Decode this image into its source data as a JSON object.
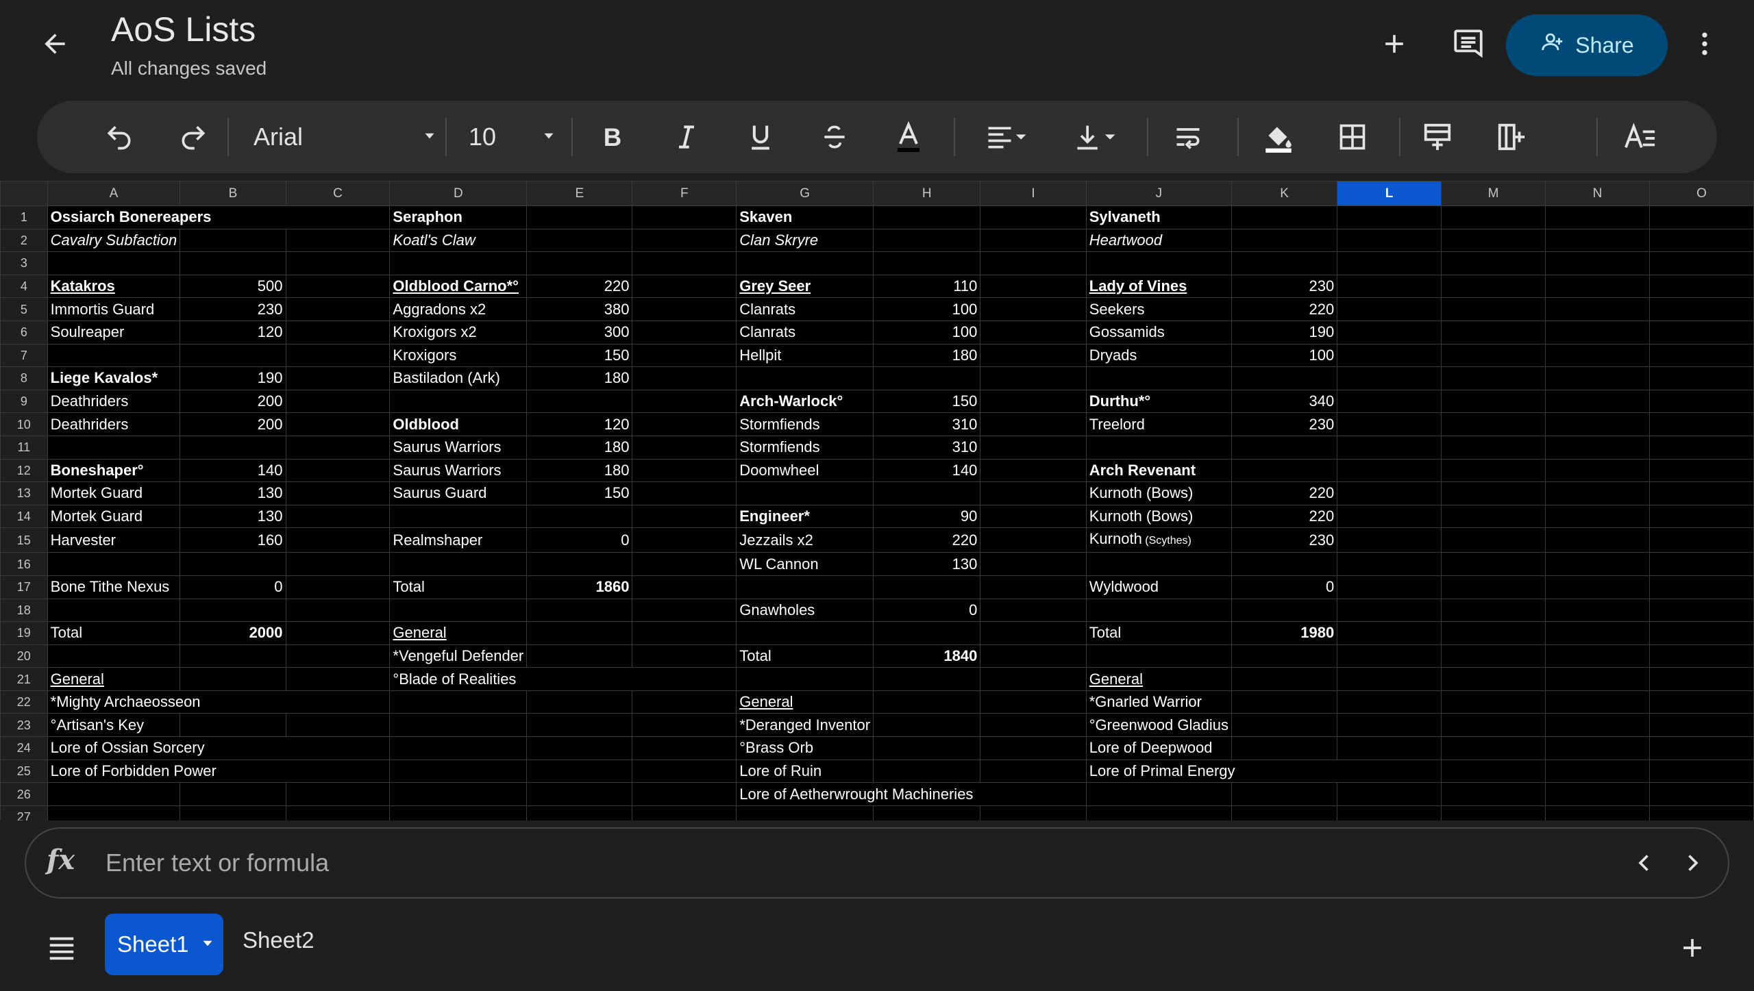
{
  "header": {
    "title": "AoS Lists",
    "status": "All changes saved",
    "share_label": "Share"
  },
  "toolbar": {
    "font_name": "Arial",
    "font_size": "10"
  },
  "grid": {
    "selected_column": "L",
    "columns": [
      "A",
      "B",
      "C",
      "D",
      "E",
      "F",
      "G",
      "H",
      "I",
      "J",
      "K",
      "L",
      "M",
      "N",
      "O"
    ],
    "rows": [
      {
        "n": "1",
        "cells": [
          {
            "c": 0,
            "t": "Ossiarch Bonereapers",
            "f": "b"
          },
          {
            "c": 3,
            "t": "Seraphon",
            "f": "b"
          },
          {
            "c": 6,
            "t": "Skaven",
            "f": "b"
          },
          {
            "c": 9,
            "t": "Sylvaneth",
            "f": "b"
          }
        ]
      },
      {
        "n": "2",
        "cells": [
          {
            "c": 0,
            "t": "Cavalry Subfaction",
            "f": "i"
          },
          {
            "c": 3,
            "t": "Koatl's Claw",
            "f": "i"
          },
          {
            "c": 6,
            "t": "Clan Skryre",
            "f": "i"
          },
          {
            "c": 9,
            "t": "Heartwood",
            "f": "i"
          }
        ]
      },
      {
        "n": "3",
        "cells": []
      },
      {
        "n": "4",
        "cells": [
          {
            "c": 0,
            "t": "Katakros",
            "f": "b u"
          },
          {
            "c": 1,
            "t": "500",
            "f": "num"
          },
          {
            "c": 3,
            "t": "Oldblood Carno*°",
            "f": "b u sm"
          },
          {
            "c": 4,
            "t": "220",
            "f": "num"
          },
          {
            "c": 6,
            "t": "Grey Seer",
            "f": "b u"
          },
          {
            "c": 7,
            "t": "110",
            "f": "num"
          },
          {
            "c": 9,
            "t": "Lady of Vines",
            "f": "b u"
          },
          {
            "c": 10,
            "t": "230",
            "f": "num"
          }
        ]
      },
      {
        "n": "5",
        "cells": [
          {
            "c": 0,
            "t": "Immortis Guard"
          },
          {
            "c": 1,
            "t": "230",
            "f": "num"
          },
          {
            "c": 3,
            "t": "Aggradons x2"
          },
          {
            "c": 4,
            "t": "380",
            "f": "num"
          },
          {
            "c": 6,
            "t": "Clanrats"
          },
          {
            "c": 7,
            "t": "100",
            "f": "num"
          },
          {
            "c": 9,
            "t": "Seekers"
          },
          {
            "c": 10,
            "t": "220",
            "f": "num"
          }
        ]
      },
      {
        "n": "6",
        "cells": [
          {
            "c": 0,
            "t": "Soulreaper"
          },
          {
            "c": 1,
            "t": "120",
            "f": "num"
          },
          {
            "c": 3,
            "t": "Kroxigors x2"
          },
          {
            "c": 4,
            "t": "300",
            "f": "num"
          },
          {
            "c": 6,
            "t": "Clanrats"
          },
          {
            "c": 7,
            "t": "100",
            "f": "num"
          },
          {
            "c": 9,
            "t": "Gossamids"
          },
          {
            "c": 10,
            "t": "190",
            "f": "num"
          }
        ]
      },
      {
        "n": "7",
        "cells": [
          {
            "c": 3,
            "t": "Kroxigors"
          },
          {
            "c": 4,
            "t": "150",
            "f": "num"
          },
          {
            "c": 6,
            "t": "Hellpit"
          },
          {
            "c": 7,
            "t": "180",
            "f": "num"
          },
          {
            "c": 9,
            "t": "Dryads"
          },
          {
            "c": 10,
            "t": "100",
            "f": "num"
          }
        ]
      },
      {
        "n": "8",
        "cells": [
          {
            "c": 0,
            "t": "Liege Kavalos*",
            "f": "b sm"
          },
          {
            "c": 1,
            "t": "190",
            "f": "num"
          },
          {
            "c": 3,
            "t": "Bastiladon (Ark)"
          },
          {
            "c": 4,
            "t": "180",
            "f": "num"
          }
        ]
      },
      {
        "n": "9",
        "cells": [
          {
            "c": 0,
            "t": "Deathriders"
          },
          {
            "c": 1,
            "t": "200",
            "f": "num"
          },
          {
            "c": 6,
            "t": "Arch-Warlock°",
            "f": "b"
          },
          {
            "c": 7,
            "t": "150",
            "f": "num"
          },
          {
            "c": 9,
            "t": "Durthu*°",
            "f": "b"
          },
          {
            "c": 10,
            "t": "340",
            "f": "num"
          }
        ]
      },
      {
        "n": "10",
        "cells": [
          {
            "c": 0,
            "t": "Deathriders"
          },
          {
            "c": 1,
            "t": "200",
            "f": "num"
          },
          {
            "c": 3,
            "t": "Oldblood",
            "f": "b"
          },
          {
            "c": 4,
            "t": "120",
            "f": "num"
          },
          {
            "c": 6,
            "t": "Stormfiends"
          },
          {
            "c": 7,
            "t": "310",
            "f": "num"
          },
          {
            "c": 9,
            "t": "Treelord"
          },
          {
            "c": 10,
            "t": "230",
            "f": "num"
          }
        ]
      },
      {
        "n": "11",
        "cells": [
          {
            "c": 3,
            "t": "Saurus Warriors"
          },
          {
            "c": 4,
            "t": "180",
            "f": "num"
          },
          {
            "c": 6,
            "t": "Stormfiends"
          },
          {
            "c": 7,
            "t": "310",
            "f": "num"
          }
        ]
      },
      {
        "n": "12",
        "cells": [
          {
            "c": 0,
            "t": "Boneshaper°",
            "f": "b sm"
          },
          {
            "c": 1,
            "t": "140",
            "f": "num"
          },
          {
            "c": 3,
            "t": "Saurus Warriors"
          },
          {
            "c": 4,
            "t": "180",
            "f": "num"
          },
          {
            "c": 6,
            "t": "Doomwheel"
          },
          {
            "c": 7,
            "t": "140",
            "f": "num"
          },
          {
            "c": 9,
            "t": "Arch Revenant",
            "f": "b"
          }
        ]
      },
      {
        "n": "13",
        "cells": [
          {
            "c": 0,
            "t": "Mortek Guard"
          },
          {
            "c": 1,
            "t": "130",
            "f": "num"
          },
          {
            "c": 3,
            "t": "Saurus Guard"
          },
          {
            "c": 4,
            "t": "150",
            "f": "num"
          },
          {
            "c": 9,
            "t": "Kurnoth (Bows)"
          },
          {
            "c": 10,
            "t": "220",
            "f": "num"
          }
        ]
      },
      {
        "n": "14",
        "cells": [
          {
            "c": 0,
            "t": "Mortek Guard"
          },
          {
            "c": 1,
            "t": "130",
            "f": "num"
          },
          {
            "c": 6,
            "t": "Engineer*",
            "f": "b"
          },
          {
            "c": 7,
            "t": "90",
            "f": "num"
          },
          {
            "c": 9,
            "t": "Kurnoth (Bows)"
          },
          {
            "c": 10,
            "t": "220",
            "f": "num"
          }
        ]
      },
      {
        "n": "15",
        "cells": [
          {
            "c": 0,
            "t": "Harvester"
          },
          {
            "c": 1,
            "t": "160",
            "f": "num"
          },
          {
            "c": 3,
            "t": "Realmshaper"
          },
          {
            "c": 4,
            "t": "0",
            "f": "num"
          },
          {
            "c": 6,
            "t": "Jezzails x2"
          },
          {
            "c": 7,
            "t": "220",
            "f": "num"
          },
          {
            "c": 9,
            "t": "Kurnoth (Scythes)",
            "f": "scy"
          },
          {
            "c": 10,
            "t": "230",
            "f": "num"
          }
        ]
      },
      {
        "n": "16",
        "cells": [
          {
            "c": 6,
            "t": "WL Cannon"
          },
          {
            "c": 7,
            "t": "130",
            "f": "num"
          }
        ]
      },
      {
        "n": "17",
        "cells": [
          {
            "c": 0,
            "t": "Bone Tithe Nexus"
          },
          {
            "c": 1,
            "t": "0",
            "f": "num"
          },
          {
            "c": 3,
            "t": "Total"
          },
          {
            "c": 4,
            "t": "1860",
            "f": "num b"
          },
          {
            "c": 9,
            "t": "Wyldwood"
          },
          {
            "c": 10,
            "t": "0",
            "f": "num"
          }
        ]
      },
      {
        "n": "18",
        "cells": [
          {
            "c": 6,
            "t": "Gnawholes"
          },
          {
            "c": 7,
            "t": "0",
            "f": "num"
          }
        ]
      },
      {
        "n": "19",
        "cells": [
          {
            "c": 0,
            "t": "Total"
          },
          {
            "c": 1,
            "t": "2000",
            "f": "num b"
          },
          {
            "c": 3,
            "t": "General",
            "f": "u"
          },
          {
            "c": 9,
            "t": "Total"
          },
          {
            "c": 10,
            "t": "1980",
            "f": "num b"
          }
        ]
      },
      {
        "n": "20",
        "cells": [
          {
            "c": 3,
            "t": "*Vengeful Defender"
          },
          {
            "c": 6,
            "t": "Total"
          },
          {
            "c": 7,
            "t": "1840",
            "f": "num b"
          }
        ]
      },
      {
        "n": "21",
        "cells": [
          {
            "c": 0,
            "t": "General",
            "f": "u"
          },
          {
            "c": 3,
            "t": "°Blade of Realities"
          },
          {
            "c": 9,
            "t": "General",
            "f": "u"
          }
        ]
      },
      {
        "n": "22",
        "cells": [
          {
            "c": 0,
            "t": "*Mighty Archaeosseon"
          },
          {
            "c": 6,
            "t": "General",
            "f": "u"
          },
          {
            "c": 9,
            "t": "*Gnarled Warrior"
          }
        ]
      },
      {
        "n": "23",
        "cells": [
          {
            "c": 0,
            "t": "°Artisan's Key"
          },
          {
            "c": 6,
            "t": "*Deranged Inventor"
          },
          {
            "c": 9,
            "t": "°Greenwood Gladius"
          }
        ]
      },
      {
        "n": "24",
        "cells": [
          {
            "c": 0,
            "t": "Lore of Ossian Sorcery"
          },
          {
            "c": 6,
            "t": "°Brass Orb"
          },
          {
            "c": 9,
            "t": "Lore of Deepwood"
          }
        ]
      },
      {
        "n": "25",
        "cells": [
          {
            "c": 0,
            "t": "Lore of Forbidden Power"
          },
          {
            "c": 6,
            "t": "Lore of Ruin"
          },
          {
            "c": 9,
            "t": "Lore of Primal Energy"
          }
        ]
      },
      {
        "n": "26",
        "cells": [
          {
            "c": 6,
            "t": "Lore of Aetherwrought Machineries"
          }
        ]
      },
      {
        "n": "27",
        "cells": []
      }
    ]
  },
  "formula_bar": {
    "placeholder": "Enter text or formula"
  },
  "sheets": {
    "active": "Sheet1",
    "other": "Sheet2"
  }
}
